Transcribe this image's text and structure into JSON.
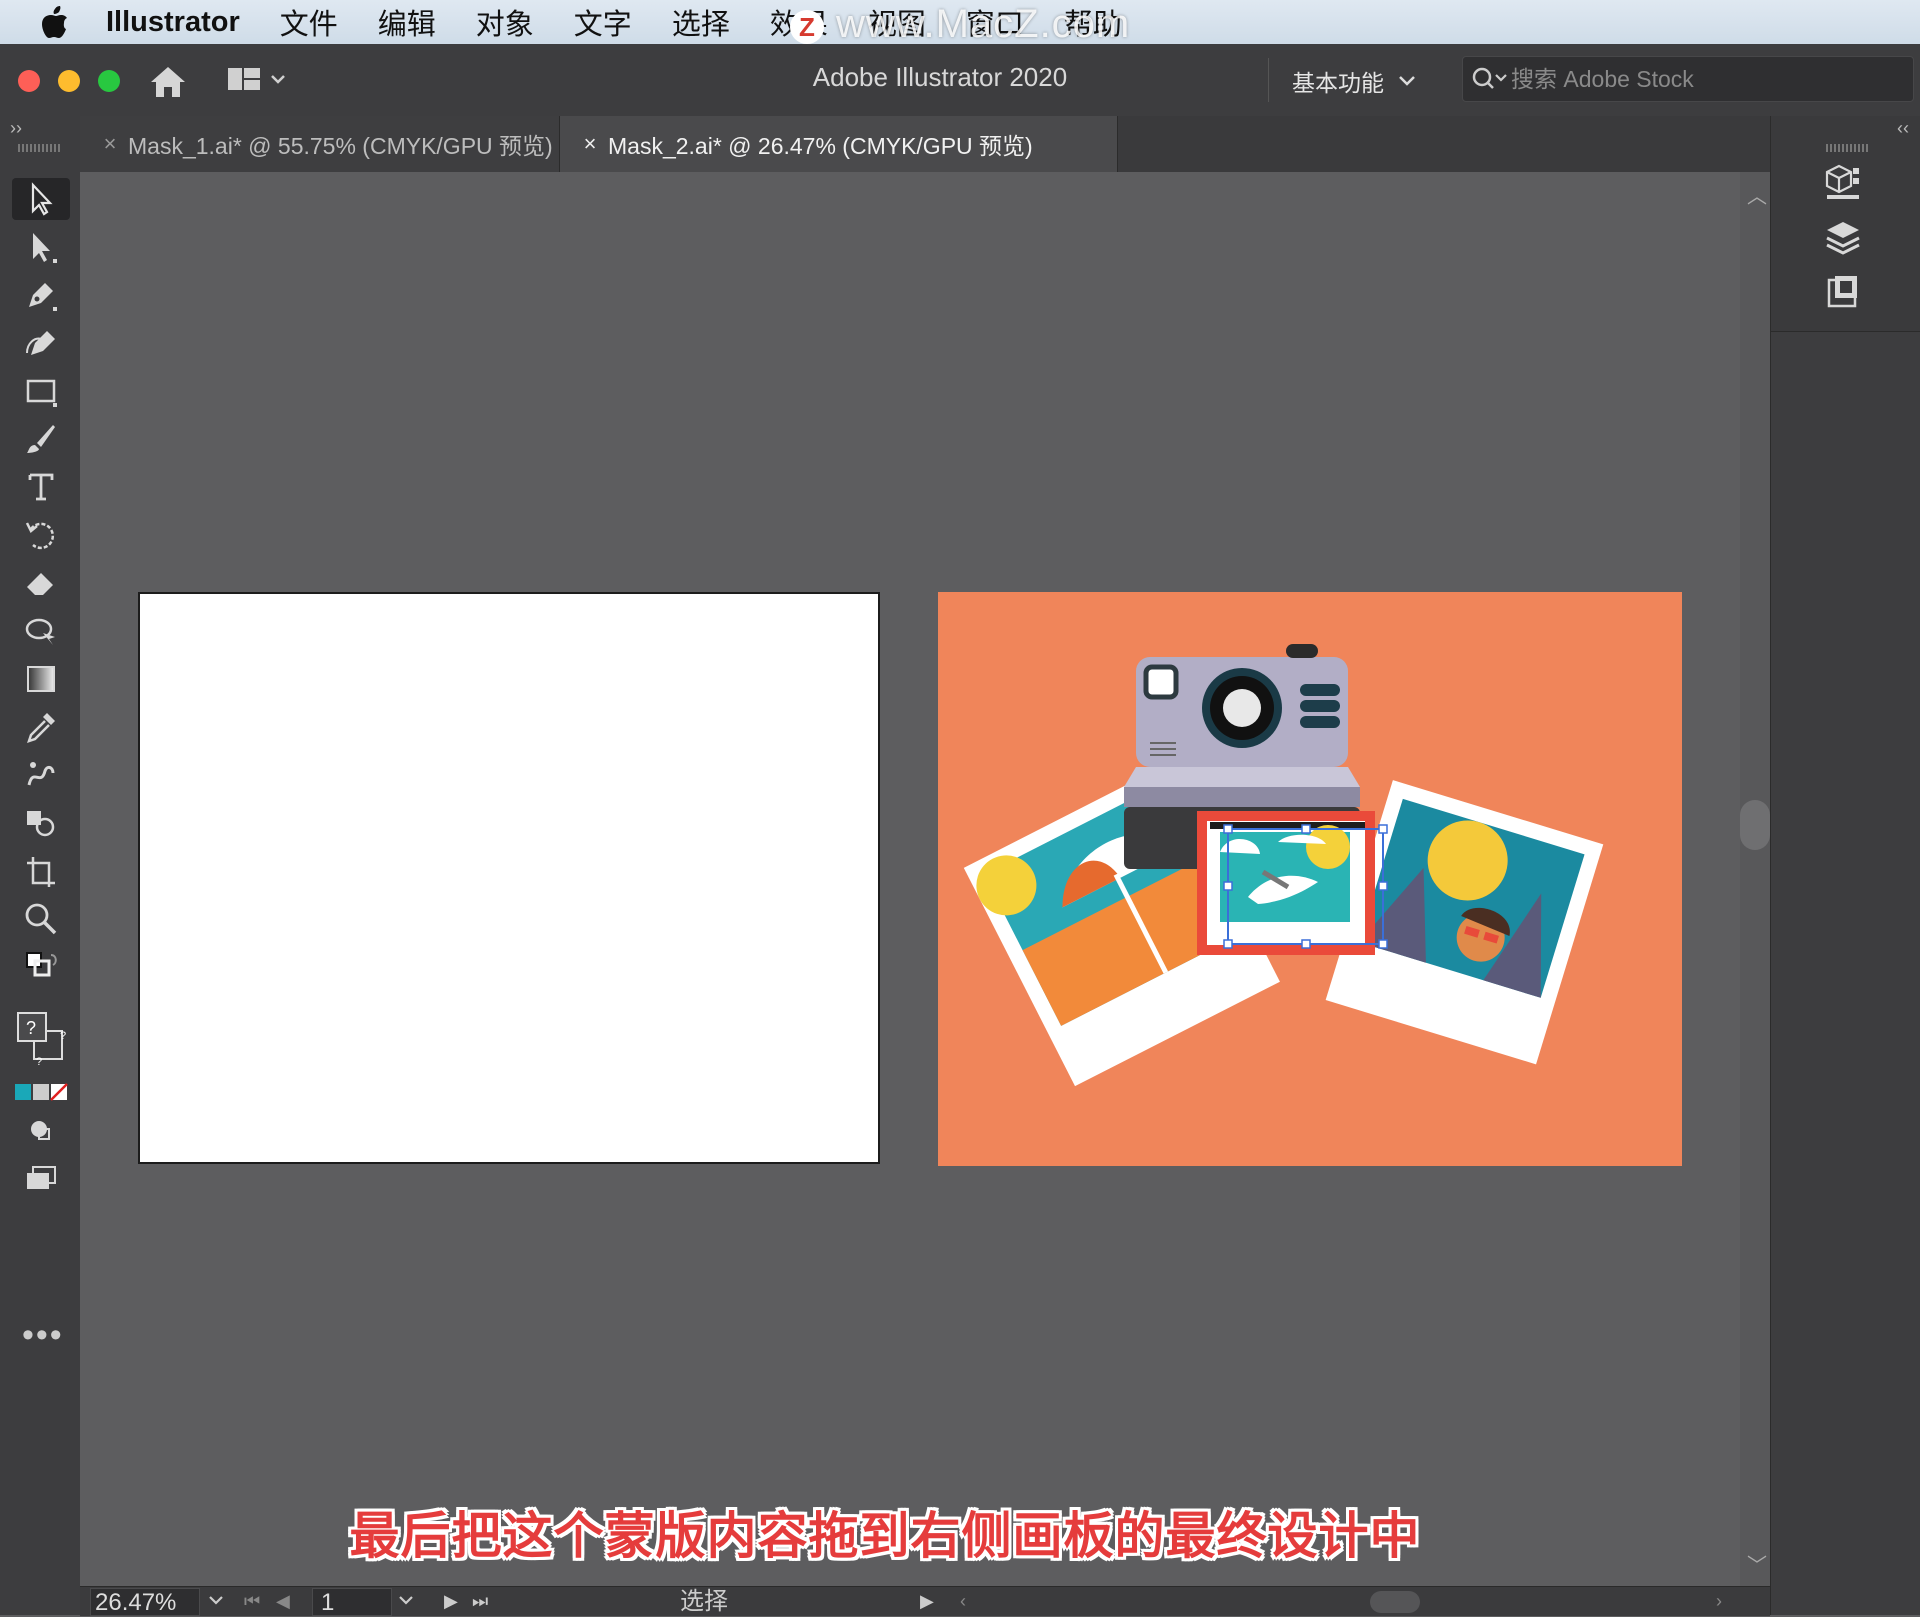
{
  "menubar": {
    "app_name": "Illustrator",
    "items": [
      "文件",
      "编辑",
      "对象",
      "文字",
      "选择",
      "效果",
      "视图",
      "窗口",
      "帮助"
    ],
    "watermark": "www.MacZ.com",
    "watermark_logo": "Z"
  },
  "titlebar": {
    "title": "Adobe Illustrator 2020",
    "workspace": "基本功能",
    "search_placeholder": "搜索 Adobe Stock"
  },
  "tabs": [
    {
      "label": "Mask_1.ai* @ 55.75% (CMYK/GPU 预览)",
      "close": "×"
    },
    {
      "label": "Mask_2.ai* @ 26.47% (CMYK/GPU 预览)",
      "close": "×"
    }
  ],
  "panel": {
    "collapse_left": "››",
    "collapse_right": "‹‹",
    "more": "•••"
  },
  "subtitle": "最后把这个蒙版内容拖到右侧画板的最终设计中",
  "statusbar": {
    "zoom": "26.47%",
    "page": "1",
    "status": "选择"
  },
  "colors": {
    "artboard_bg": "#f0855a",
    "subtitle": "#e53c3c",
    "selection": "#3b6fd8",
    "camera_body": "#b2aec6"
  }
}
